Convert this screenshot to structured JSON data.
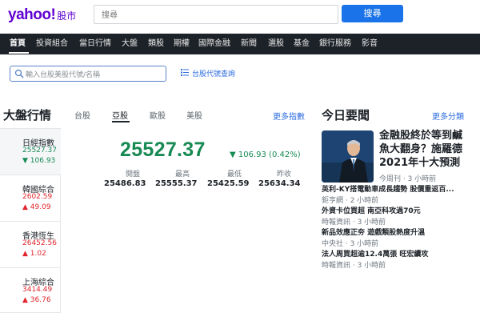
{
  "header": {
    "logo_text": "yahoo!",
    "logo_sub": "股市",
    "search_placeholder": "搜尋",
    "search_button": "搜尋"
  },
  "nav": {
    "items": [
      "首頁",
      "投資組合",
      "當日行情",
      "大盤",
      "類股",
      "期權",
      "國際金融",
      "新聞",
      "選股",
      "基金",
      "銀行服務",
      "影音"
    ]
  },
  "stock_search": {
    "placeholder": "輸入台股美股代號/名稱",
    "code_query": "台股代號查詢"
  },
  "market": {
    "title": "大盤行情",
    "tabs": [
      "台股",
      "亞股",
      "歐股",
      "美股"
    ],
    "more": "更多指數",
    "indices": [
      {
        "name": "日經指數",
        "value": "25527.37",
        "change": "106.93",
        "direction": "down"
      },
      {
        "name": "韓國綜合",
        "value": "2602.59",
        "change": "49.09",
        "direction": "up"
      },
      {
        "name": "香港恆生",
        "value": "26452.56",
        "change": "1.02",
        "direction": "up"
      },
      {
        "name": "上海綜合",
        "value": "3414.49",
        "change": "36.76",
        "direction": "up"
      }
    ],
    "selected": {
      "value": "25527.37",
      "change": "106.93 (0.42%)",
      "stats": [
        {
          "label": "開盤",
          "value": "25486.83"
        },
        {
          "label": "最高",
          "value": "25555.37"
        },
        {
          "label": "最低",
          "value": "25425.59"
        },
        {
          "label": "昨收",
          "value": "25634.34"
        }
      ]
    }
  },
  "news": {
    "title": "今日要聞",
    "more": "更多分類",
    "headline_lines": [
      "金融股終於等到鹹",
      "魚大翻身？施羅德",
      "2021年十大預測"
    ],
    "headline_src": "今周刊 · 3 小時前",
    "items": [
      {
        "text": "英利-KY搭電動車成長趨勢 股價重返百..."
      },
      {
        "source": "鉅亨網 · 2 小時前",
        "text": "外資卡位買超 南亞科攻過70元"
      },
      {
        "source": "時報資訊 · 3 小時前",
        "text": "新品效應正夯 遊戲類股熱度升溫"
      },
      {
        "source": "中央社 · 3 小時前",
        "text": "法人周買超逾12.4萬張 旺宏續攻"
      },
      {
        "source": "時報資訊 · 3 小時前"
      }
    ]
  },
  "colors": {
    "brand": "#6001d2",
    "down": "#188a54",
    "up": "#e0262c",
    "link": "#2d6cdf",
    "nav_bg": "#1d2228"
  }
}
